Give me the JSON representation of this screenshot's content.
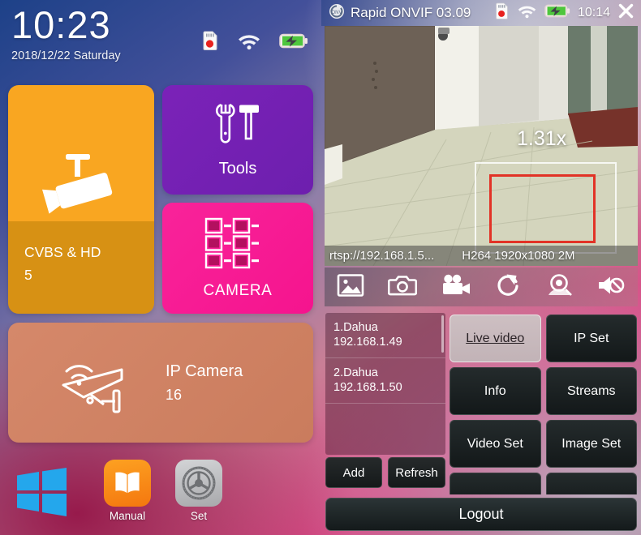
{
  "launcher": {
    "clock": {
      "time": "10:23",
      "date": "2018/12/22 Saturday"
    },
    "status_icons": [
      "sdcard-icon",
      "wifi-icon",
      "battery-charging-icon"
    ],
    "tiles": [
      {
        "id": "cvbs",
        "label": "CVBS & HD",
        "count": "5",
        "icon": "cctv-camera-icon",
        "color": "#f9a621",
        "color_bottom": "#d79114"
      },
      {
        "id": "tools",
        "label": "Tools",
        "icon": "wrench-hammer-icon",
        "color": "#7b22b8"
      },
      {
        "id": "camera",
        "label": "CAMERA",
        "icon": "camera-grid-icon",
        "color": "#f9239a"
      },
      {
        "id": "ipcamera",
        "label": "IP Camera",
        "count": "16",
        "icon": "wireless-camera-icon",
        "color": "#ca7c5d"
      }
    ],
    "dock": [
      {
        "id": "windows",
        "label": "",
        "icon": "windows-logo-icon"
      },
      {
        "id": "manual",
        "label": "Manual",
        "icon": "book-icon"
      },
      {
        "id": "set",
        "label": "Set",
        "icon": "gear-icon"
      }
    ]
  },
  "app": {
    "title": "Rapid ONVIF 03.09",
    "titlebar_icons": [
      "sdcard-icon",
      "wifi-icon",
      "battery-charging-icon"
    ],
    "time": "10:14",
    "close_label": "✕",
    "video": {
      "zoom_level": "1.31x",
      "rtsp_url": "rtsp://192.168.1.5...",
      "stream_info": "H264 1920x1080 2M"
    },
    "media_toolbar": [
      {
        "name": "gallery-icon"
      },
      {
        "name": "snapshot-icon"
      },
      {
        "name": "record-icon"
      },
      {
        "name": "rotate-refresh-icon"
      },
      {
        "name": "ptz-camera-icon"
      },
      {
        "name": "mute-speaker-icon"
      }
    ],
    "device_list": [
      {
        "name": "1.Dahua",
        "ip": "192.168.1.49"
      },
      {
        "name": "2.Dahua",
        "ip": "192.168.1.50"
      }
    ],
    "list_actions": {
      "add": "Add",
      "refresh": "Refresh"
    },
    "action_buttons": [
      {
        "label": "Live video",
        "active": true
      },
      {
        "label": "IP Set",
        "active": false
      },
      {
        "label": "Info",
        "active": false
      },
      {
        "label": "Streams",
        "active": false
      },
      {
        "label": "Video Set",
        "active": false
      },
      {
        "label": "Image Set",
        "active": false
      },
      {
        "label": "",
        "active": false
      },
      {
        "label": "",
        "active": false
      }
    ],
    "logout_label": "Logout"
  },
  "colors": {
    "accent_pink": "#f5148e",
    "accent_orange": "#f9a621",
    "accent_purple": "#7b22b8",
    "accent_salmon": "#ca7c5d",
    "zoom_rect_red": "#e23226"
  }
}
